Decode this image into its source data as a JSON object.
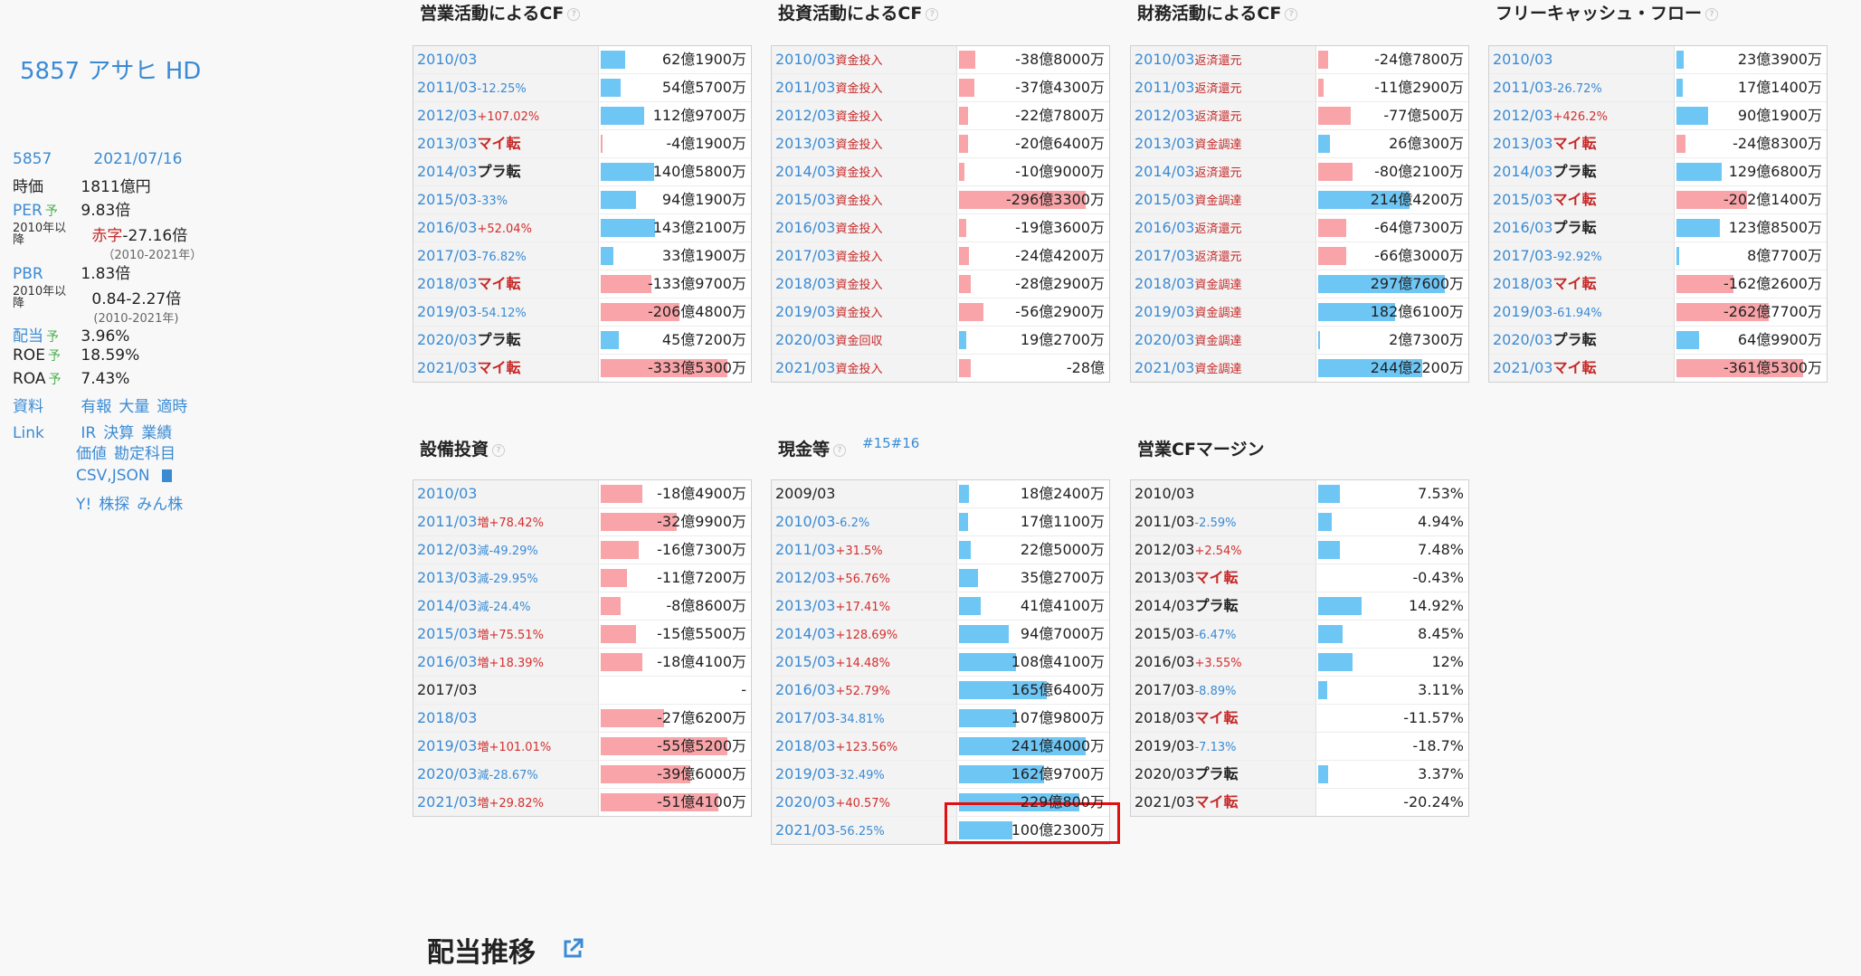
{
  "sidebar": {
    "title": "5857 アサヒ HD",
    "code": "5857",
    "date": "2021/07/16",
    "rows": [
      {
        "k": "時価",
        "v": "1811億円"
      },
      {
        "k": "PER",
        "yo": "予",
        "v": "9.83倍"
      },
      {
        "k": "ROE",
        "yo": "予",
        "v": "18.59%"
      },
      {
        "k": "ROA",
        "yo": "予",
        "v": "7.43%"
      }
    ],
    "per_since_label": "2010年以降",
    "per_range_prefix": "赤字",
    "per_range": "-27.16倍",
    "per_range_years": "（2010-2021年）",
    "pbr_label": "PBR",
    "pbr_value": "1.83倍",
    "pbr_range": "0.84-2.27倍",
    "pbr_range_years": "(2010-2021年)",
    "dividend_label": "配当",
    "dividend_yo": "予",
    "dividend_value": "3.96%",
    "docs_label": "資料",
    "docs": [
      "有報",
      "大量",
      "適時"
    ],
    "link_label": "Link",
    "links1": [
      "IR",
      "決算",
      "業績"
    ],
    "links2": [
      "価値",
      "勘定科目"
    ],
    "csv": "CSV,JSON",
    "links3": [
      "Y!",
      "株探",
      "みん株"
    ]
  },
  "tables": [
    {
      "id": "op-cf",
      "title": "営業活動によるCF",
      "extra": "",
      "rows": [
        {
          "year": "2010/03",
          "chg": "",
          "mark": "",
          "value": "62億1900万",
          "bar": 0.19,
          "color": "blue"
        },
        {
          "year": "2011/03",
          "chg": "-12.25%",
          "mark": "",
          "value": "54億5700万",
          "bar": 0.16,
          "color": "blue"
        },
        {
          "year": "2012/03",
          "chg": "+107.02%",
          "mark": "",
          "value": "112億9700万",
          "bar": 0.34,
          "color": "blue"
        },
        {
          "year": "2013/03",
          "chg": "",
          "mark": "マイ転",
          "value": "-4億1900万",
          "bar": 0.01,
          "color": "pink"
        },
        {
          "year": "2014/03",
          "chg": "",
          "mark": "プラ転",
          "value": "140億5800万",
          "bar": 0.42,
          "color": "blue"
        },
        {
          "year": "2015/03",
          "chg": "-33%",
          "mark": "",
          "value": "94億1900万",
          "bar": 0.28,
          "color": "blue"
        },
        {
          "year": "2016/03",
          "chg": "+52.04%",
          "mark": "",
          "value": "143億2100万",
          "bar": 0.43,
          "color": "blue"
        },
        {
          "year": "2017/03",
          "chg": "-76.82%",
          "mark": "",
          "value": "33億1900万",
          "bar": 0.1,
          "color": "blue"
        },
        {
          "year": "2018/03",
          "chg": "",
          "mark": "マイ転",
          "value": "-133億9700万",
          "bar": 0.4,
          "color": "pink"
        },
        {
          "year": "2019/03",
          "chg": "-54.12%",
          "mark": "",
          "value": "-206億4800万",
          "bar": 0.62,
          "color": "pink"
        },
        {
          "year": "2020/03",
          "chg": "",
          "mark": "プラ転",
          "value": "45億7200万",
          "bar": 0.14,
          "color": "blue"
        },
        {
          "year": "2021/03",
          "chg": "",
          "mark": "マイ転",
          "value": "-333億5300万",
          "bar": 1.0,
          "color": "pink"
        }
      ]
    },
    {
      "id": "inv-cf",
      "title": "投資活動によるCF",
      "extra": "",
      "rows": [
        {
          "year": "2010/03",
          "tag": "資金投入",
          "value": "-38億8000万",
          "bar": 0.13,
          "color": "pink"
        },
        {
          "year": "2011/03",
          "tag": "資金投入",
          "value": "-37億4300万",
          "bar": 0.12,
          "color": "pink"
        },
        {
          "year": "2012/03",
          "tag": "資金投入",
          "value": "-22億7800万",
          "bar": 0.07,
          "color": "pink"
        },
        {
          "year": "2013/03",
          "tag": "資金投入",
          "value": "-20億6400万",
          "bar": 0.07,
          "color": "pink"
        },
        {
          "year": "2014/03",
          "tag": "資金投入",
          "value": "-10億9000万",
          "bar": 0.04,
          "color": "pink"
        },
        {
          "year": "2015/03",
          "tag": "資金投入",
          "value": "-296億3300万",
          "bar": 1.0,
          "color": "pink"
        },
        {
          "year": "2016/03",
          "tag": "資金投入",
          "value": "-19億3600万",
          "bar": 0.06,
          "color": "pink"
        },
        {
          "year": "2017/03",
          "tag": "資金投入",
          "value": "-24億4200万",
          "bar": 0.08,
          "color": "pink"
        },
        {
          "year": "2018/03",
          "tag": "資金投入",
          "value": "-28億2900万",
          "bar": 0.09,
          "color": "pink"
        },
        {
          "year": "2019/03",
          "tag": "資金投入",
          "value": "-56億2900万",
          "bar": 0.19,
          "color": "pink"
        },
        {
          "year": "2020/03",
          "tag": "資金回収",
          "value": "19億2700万",
          "bar": 0.06,
          "color": "blue"
        },
        {
          "year": "2021/03",
          "tag": "資金投入",
          "value": "-28億",
          "bar": 0.09,
          "color": "pink"
        }
      ]
    },
    {
      "id": "fin-cf",
      "title": "財務活動によるCF",
      "extra": "",
      "rows": [
        {
          "year": "2010/03",
          "tag": "返済還元",
          "value": "-24億7800万",
          "bar": 0.08,
          "color": "pink"
        },
        {
          "year": "2011/03",
          "tag": "返済還元",
          "value": "-11億2900万",
          "bar": 0.04,
          "color": "pink"
        },
        {
          "year": "2012/03",
          "tag": "返済還元",
          "value": "-77億500万",
          "bar": 0.26,
          "color": "pink"
        },
        {
          "year": "2013/03",
          "tag": "資金調達",
          "value": "26億300万",
          "bar": 0.09,
          "color": "blue"
        },
        {
          "year": "2014/03",
          "tag": "返済還元",
          "value": "-80億2100万",
          "bar": 0.27,
          "color": "pink"
        },
        {
          "year": "2015/03",
          "tag": "資金調達",
          "value": "214億4200万",
          "bar": 0.72,
          "color": "blue"
        },
        {
          "year": "2016/03",
          "tag": "返済還元",
          "value": "-64億7300万",
          "bar": 0.22,
          "color": "pink"
        },
        {
          "year": "2017/03",
          "tag": "返済還元",
          "value": "-66億3000万",
          "bar": 0.22,
          "color": "pink"
        },
        {
          "year": "2018/03",
          "tag": "資金調達",
          "value": "297億7600万",
          "bar": 1.0,
          "color": "blue"
        },
        {
          "year": "2019/03",
          "tag": "資金調達",
          "value": "182億6100万",
          "bar": 0.61,
          "color": "blue"
        },
        {
          "year": "2020/03",
          "tag": "資金調達",
          "value": "2億7300万",
          "bar": 0.01,
          "color": "blue"
        },
        {
          "year": "2021/03",
          "tag": "資金調達",
          "value": "244億2200万",
          "bar": 0.82,
          "color": "blue"
        }
      ]
    },
    {
      "id": "fcf",
      "title": "フリーキャッシュ・フロー",
      "extra": "",
      "rows": [
        {
          "year": "2010/03",
          "chg": "",
          "mark": "",
          "value": "23億3900万",
          "bar": 0.06,
          "color": "blue"
        },
        {
          "year": "2011/03",
          "chg": "-26.72%",
          "mark": "",
          "value": "17億1400万",
          "bar": 0.05,
          "color": "blue"
        },
        {
          "year": "2012/03",
          "chg": "+426.2%",
          "mark": "",
          "value": "90億1900万",
          "bar": 0.25,
          "color": "blue"
        },
        {
          "year": "2013/03",
          "chg": "",
          "mark": "マイ転",
          "value": "-24億8300万",
          "bar": 0.07,
          "color": "pink"
        },
        {
          "year": "2014/03",
          "chg": "",
          "mark": "プラ転",
          "value": "129億6800万",
          "bar": 0.36,
          "color": "blue"
        },
        {
          "year": "2015/03",
          "chg": "",
          "mark": "マイ転",
          "value": "-202億1400万",
          "bar": 0.56,
          "color": "pink"
        },
        {
          "year": "2016/03",
          "chg": "",
          "mark": "プラ転",
          "value": "123億8500万",
          "bar": 0.34,
          "color": "blue"
        },
        {
          "year": "2017/03",
          "chg": "-92.92%",
          "mark": "",
          "value": "8億7700万",
          "bar": 0.02,
          "color": "blue"
        },
        {
          "year": "2018/03",
          "chg": "",
          "mark": "マイ転",
          "value": "-162億2600万",
          "bar": 0.45,
          "color": "pink"
        },
        {
          "year": "2019/03",
          "chg": "-61.94%",
          "mark": "",
          "value": "-262億7700万",
          "bar": 0.73,
          "color": "pink"
        },
        {
          "year": "2020/03",
          "chg": "",
          "mark": "プラ転",
          "value": "64億9900万",
          "bar": 0.18,
          "color": "blue"
        },
        {
          "year": "2021/03",
          "chg": "",
          "mark": "マイ転",
          "value": "-361億5300万",
          "bar": 1.0,
          "color": "pink"
        }
      ]
    },
    {
      "id": "capex",
      "title": "設備投資",
      "extra": "",
      "rows": [
        {
          "year": "2010/03",
          "chg": "",
          "value": "-18億4900万",
          "bar": 0.33,
          "color": "pink"
        },
        {
          "year": "2011/03",
          "chg": "増+78.42%",
          "value": "-32億9900万",
          "bar": 0.6,
          "color": "pink"
        },
        {
          "year": "2012/03",
          "chg": "減-49.29%",
          "value": "-16億7300万",
          "bar": 0.3,
          "color": "pink"
        },
        {
          "year": "2013/03",
          "chg": "減-29.95%",
          "value": "-11億7200万",
          "bar": 0.21,
          "color": "pink"
        },
        {
          "year": "2014/03",
          "chg": "減-24.4%",
          "value": "-8億8600万",
          "bar": 0.16,
          "color": "pink"
        },
        {
          "year": "2015/03",
          "chg": "増+75.51%",
          "value": "-15億5500万",
          "bar": 0.28,
          "color": "pink"
        },
        {
          "year": "2016/03",
          "chg": "増+18.39%",
          "value": "-18億4100万",
          "bar": 0.33,
          "color": "pink"
        },
        {
          "year": "2017/03",
          "chg": "",
          "plain": true,
          "value": "-",
          "bar": 0,
          "color": "pink"
        },
        {
          "year": "2018/03",
          "chg": "",
          "value": "-27億6200万",
          "bar": 0.5,
          "color": "pink"
        },
        {
          "year": "2019/03",
          "chg": "増+101.01%",
          "value": "-55億5200万",
          "bar": 1.0,
          "color": "pink"
        },
        {
          "year": "2020/03",
          "chg": "減-28.67%",
          "value": "-39億6000万",
          "bar": 0.71,
          "color": "pink"
        },
        {
          "year": "2021/03",
          "chg": "増+29.82%",
          "value": "-51億4100万",
          "bar": 0.93,
          "color": "pink"
        }
      ]
    },
    {
      "id": "cash",
      "title": "現金等",
      "extra": "#15#16",
      "rows": [
        {
          "year": "2009/03",
          "chg": "",
          "plain": true,
          "value": "18億2400万",
          "bar": 0.08,
          "color": "blue"
        },
        {
          "year": "2010/03",
          "chg": "-6.2%",
          "value": "17億1100万",
          "bar": 0.07,
          "color": "blue"
        },
        {
          "year": "2011/03",
          "chg": "+31.5%",
          "value": "22億5000万",
          "bar": 0.09,
          "color": "blue"
        },
        {
          "year": "2012/03",
          "chg": "+56.76%",
          "value": "35億2700万",
          "bar": 0.15,
          "color": "blue"
        },
        {
          "year": "2013/03",
          "chg": "+17.41%",
          "value": "41億4100万",
          "bar": 0.17,
          "color": "blue"
        },
        {
          "year": "2014/03",
          "chg": "+128.69%",
          "value": "94億7000万",
          "bar": 0.39,
          "color": "blue"
        },
        {
          "year": "2015/03",
          "chg": "+14.48%",
          "value": "108億4100万",
          "bar": 0.45,
          "color": "blue"
        },
        {
          "year": "2016/03",
          "chg": "+52.79%",
          "value": "165億6400万",
          "bar": 0.69,
          "color": "blue"
        },
        {
          "year": "2017/03",
          "chg": "-34.81%",
          "value": "107億9800万",
          "bar": 0.45,
          "color": "blue"
        },
        {
          "year": "2018/03",
          "chg": "+123.56%",
          "value": "241億4000万",
          "bar": 1.0,
          "color": "blue"
        },
        {
          "year": "2019/03",
          "chg": "-32.49%",
          "value": "162億9700万",
          "bar": 0.67,
          "color": "blue"
        },
        {
          "year": "2020/03",
          "chg": "+40.57%",
          "value": "229億800万",
          "bar": 0.95,
          "color": "blue"
        },
        {
          "year": "2021/03",
          "chg": "-56.25%",
          "value": "100億2300万",
          "bar": 0.42,
          "color": "blue"
        }
      ]
    },
    {
      "id": "op-margin",
      "title": "営業CFマージン",
      "extra": "",
      "rows": [
        {
          "year": "2010/03",
          "chg": "",
          "mark": "",
          "plain": true,
          "value": "7.53%",
          "bar": 0.17,
          "color": "blue"
        },
        {
          "year": "2011/03",
          "chg": "-2.59%",
          "mark": "",
          "plain": true,
          "value": "4.94%",
          "bar": 0.11,
          "color": "blue"
        },
        {
          "year": "2012/03",
          "chg": "+2.54%",
          "mark": "",
          "plain": true,
          "value": "7.48%",
          "bar": 0.17,
          "color": "blue"
        },
        {
          "year": "2013/03",
          "chg": "",
          "mark": "マイ転",
          "plain": true,
          "value": "-0.43%",
          "bar": 0,
          "color": "pink"
        },
        {
          "year": "2014/03",
          "chg": "",
          "mark": "プラ転",
          "plain": true,
          "value": "14.92%",
          "bar": 0.34,
          "color": "blue"
        },
        {
          "year": "2015/03",
          "chg": "-6.47%",
          "mark": "",
          "plain": true,
          "value": "8.45%",
          "bar": 0.19,
          "color": "blue"
        },
        {
          "year": "2016/03",
          "chg": "+3.55%",
          "mark": "",
          "plain": true,
          "value": "12%",
          "bar": 0.27,
          "color": "blue"
        },
        {
          "year": "2017/03",
          "chg": "-8.89%",
          "mark": "",
          "plain": true,
          "value": "3.11%",
          "bar": 0.07,
          "color": "blue"
        },
        {
          "year": "2018/03",
          "chg": "",
          "mark": "マイ転",
          "plain": true,
          "value": "-11.57%",
          "bar": 0,
          "color": "pink"
        },
        {
          "year": "2019/03",
          "chg": "-7.13%",
          "mark": "",
          "plain": true,
          "value": "-18.7%",
          "bar": 0,
          "color": "pink"
        },
        {
          "year": "2020/03",
          "chg": "",
          "mark": "プラ転",
          "plain": true,
          "value": "3.37%",
          "bar": 0.08,
          "color": "blue"
        },
        {
          "year": "2021/03",
          "chg": "",
          "mark": "マイ転",
          "plain": true,
          "value": "-20.24%",
          "bar": 0,
          "color": "pink"
        }
      ]
    }
  ],
  "dividend_section": {
    "title": "配当推移"
  },
  "colors": {
    "link": "#3b8bd4",
    "bar_pos": "#6ec6f5",
    "bar_neg": "#f8a4a8",
    "highlight": "#e01010"
  }
}
